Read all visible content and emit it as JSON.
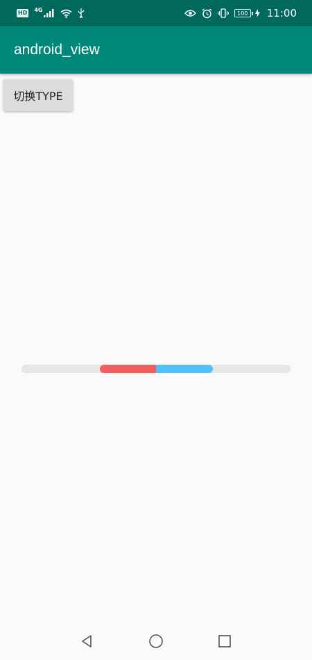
{
  "status_bar": {
    "hd": "HD",
    "network": "4G",
    "battery": "100",
    "time": "11:00",
    "icons": [
      "hd-icon",
      "signal-icon",
      "wifi-icon",
      "usb-icon",
      "eye-comfort-icon",
      "alarm-icon",
      "vibrate-icon",
      "battery-icon",
      "charging-icon"
    ]
  },
  "app_bar": {
    "title": "android_view",
    "color": "#00897b",
    "status_color": "#00695c"
  },
  "main": {
    "toggle_button_label": "切换TYPE",
    "progress": {
      "track_color": "#e6e6e6",
      "segments": [
        {
          "color": "#f25f5c"
        },
        {
          "color": "#4fc3f7"
        }
      ]
    }
  },
  "nav_bar": {
    "icons": [
      "back-icon",
      "home-icon",
      "recents-icon"
    ]
  }
}
